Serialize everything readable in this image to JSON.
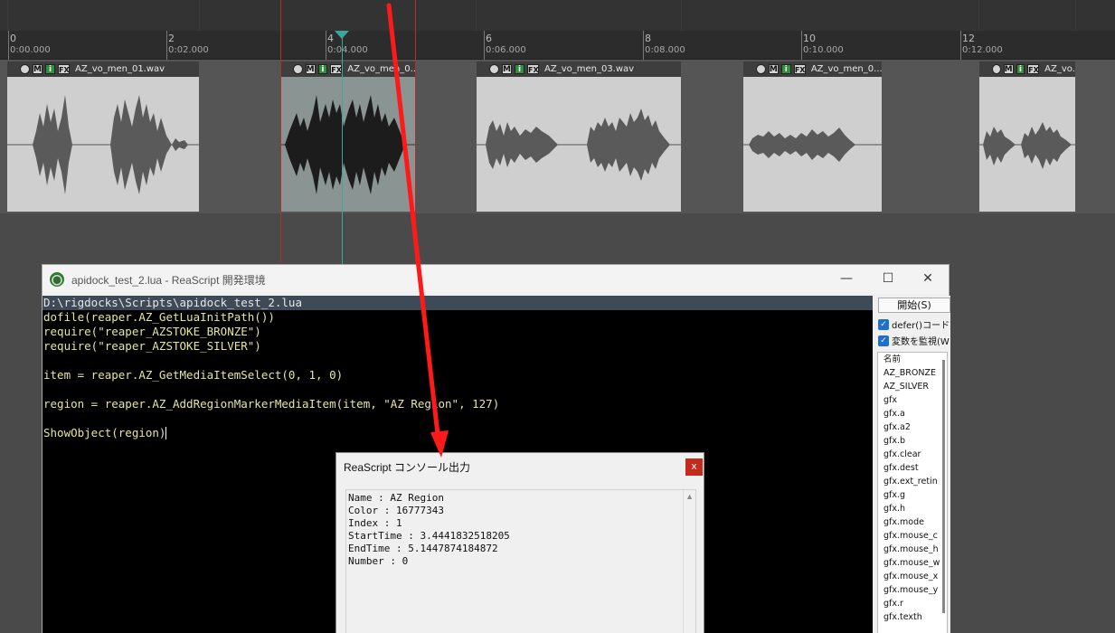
{
  "timeline": {
    "ticks": [
      {
        "bar": "0",
        "time": "0:00.000"
      },
      {
        "bar": "2",
        "time": "0:02.000"
      },
      {
        "bar": "4",
        "time": "0:04.000"
      },
      {
        "bar": "6",
        "time": "0:06.000"
      },
      {
        "bar": "8",
        "time": "0:08.000"
      },
      {
        "bar": "10",
        "time": "0:10.000"
      },
      {
        "bar": "12",
        "time": "0:12.000"
      }
    ],
    "items": [
      {
        "name": "AZ_vo_men_01.wav"
      },
      {
        "name": "AZ_vo_men_0..."
      },
      {
        "name": "AZ_vo_men_03.wav"
      },
      {
        "name": "AZ_vo_men_0..."
      },
      {
        "name": "AZ_vo..."
      }
    ],
    "item_buttons": {
      "mute": "M",
      "info": "i",
      "fx": "FX"
    }
  },
  "ide": {
    "title": "apidock_test_2.lua - ReaScript 開発環境",
    "controls": {
      "minimize": "—",
      "maximize": "☐",
      "close": "✕"
    },
    "path": "D:\\rigdocks\\Scripts\\apidock_test_2.lua",
    "code": [
      "dofile(reaper.AZ_GetLuaInitPath())",
      "require(\"reaper_AZSTOKE_BRONZE\")",
      "require(\"reaper_AZSTOKE_SILVER\")",
      "",
      "item = reaper.AZ_GetMediaItemSelect(0, 1, 0)",
      "",
      "region = reaper.AZ_AddRegionMarkerMediaItem(item, \"AZ Region\", 127)",
      "",
      "ShowObject(region)"
    ],
    "side": {
      "start_button": "開始(S)",
      "defer_checkbox": "defer()コード実",
      "watch_checkbox": "変数を監視(W",
      "var_header": "名前",
      "variables": [
        "AZ_BRONZE",
        "AZ_SILVER",
        "gfx",
        "gfx.a",
        "gfx.a2",
        "gfx.b",
        "gfx.clear",
        "gfx.dest",
        "gfx.ext_retin",
        "gfx.g",
        "gfx.h",
        "gfx.mode",
        "gfx.mouse_c",
        "gfx.mouse_h",
        "gfx.mouse_w",
        "gfx.mouse_x",
        "gfx.mouse_y",
        "gfx.r",
        "gfx.texth"
      ]
    }
  },
  "console": {
    "title": "ReaScript コンソール出力",
    "close": "x",
    "lines": [
      "Name : AZ Region",
      "Color : 16777343",
      "Index : 1",
      "StartTime : 3.4441832518205",
      "EndTime : 5.1447874184872",
      "Number : 0"
    ]
  },
  "colors": {
    "arrow": "#ff1a1a",
    "cursor": "#39a89b",
    "editor_bg": "#000000",
    "checkbox": "#1f6fd1"
  }
}
